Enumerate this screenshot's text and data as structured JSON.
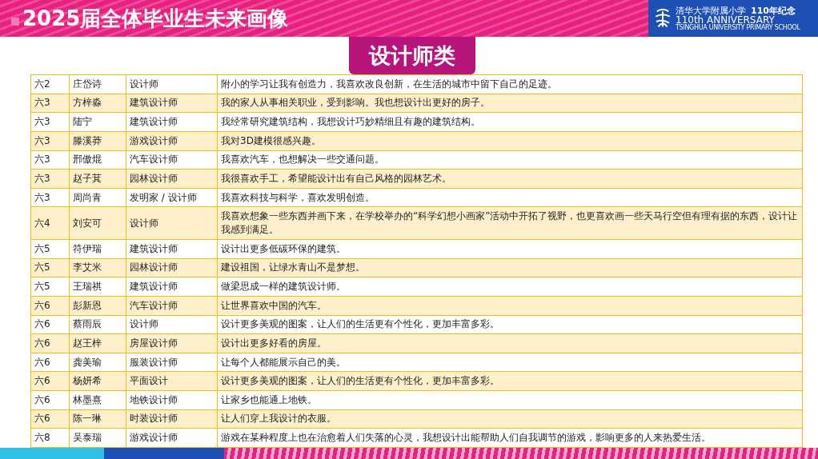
{
  "header": {
    "title": "2025届全体毕业生未来画像",
    "logo": {
      "school": "清华大学附属小学",
      "anniversary": "110年纪念",
      "english": "110th ANNIVERSARY",
      "subtitle": "TSINGHUA UNIVERSITY PRIMARY SCHOOL"
    }
  },
  "category": "设计师类",
  "table": {
    "rows": [
      {
        "class": "六2",
        "name": "庄岱诗",
        "career": "设计师",
        "reason": "附小的学习让我有创造力，我喜欢改良创新，在生活的城市中留下自己的足迹。"
      },
      {
        "class": "六3",
        "name": "方梓淼",
        "career": "建筑设计师",
        "reason": "我的家人从事相关职业，受到影响。我也想设计出更好的房子。"
      },
      {
        "class": "六3",
        "name": "陆宁",
        "career": "建筑设计师",
        "reason": "我经常研究建筑结构，我想设计巧妙精细且有趣的建筑结构。"
      },
      {
        "class": "六3",
        "name": "滕溪莽",
        "career": "游戏设计师",
        "reason": "我对3D建模很感兴趣。"
      },
      {
        "class": "六3",
        "name": "邢傲焜",
        "career": "汽车设计师",
        "reason": "我喜欢汽车，也想解决一些交通问题。"
      },
      {
        "class": "六3",
        "name": "赵子萁",
        "career": "园林设计师",
        "reason": "我很喜欢手工，希望能设计出有自己风格的园林艺术。"
      },
      {
        "class": "六3",
        "name": "周尚青",
        "career": "发明家 / 设计师",
        "reason": "我喜欢科技与科学，喜欢发明创造。"
      },
      {
        "class": "六4",
        "name": "刘安可",
        "career": "设计师",
        "reason": "我喜欢想象一些东西并画下来，在学校举办的“科学幻想小画家”活动中开拓了视野，也更喜欢画一些天马行空但有理有据的东西，设计让我感到满足。"
      },
      {
        "class": "六5",
        "name": "符伊瑞",
        "career": "建筑设计师",
        "reason": "设计出更多低碳环保的建筑。"
      },
      {
        "class": "六5",
        "name": "李艾米",
        "career": "园林设计师",
        "reason": "建设祖国，让绿水青山不是梦想。"
      },
      {
        "class": "六5",
        "name": "王瑞祺",
        "career": "建筑设计师",
        "reason": "做梁思成一样的建筑设计师。"
      },
      {
        "class": "六6",
        "name": "彭新恩",
        "career": "汽车设计师",
        "reason": "让世界喜欢中国的汽车。"
      },
      {
        "class": "六6",
        "name": "蔡雨辰",
        "career": "设计师",
        "reason": "设计更多美观的图案，让人们的生活更有个性化，更加丰富多彩。"
      },
      {
        "class": "六6",
        "name": "赵王梓",
        "career": "房屋设计师",
        "reason": "设计出更多好看的房屋。"
      },
      {
        "class": "六6",
        "name": "龚美瑜",
        "career": "服装设计师",
        "reason": "让每个人都能展示自己的美。"
      },
      {
        "class": "六6",
        "name": "杨妍希",
        "career": "平面设计",
        "reason": "设计更多美观的图案，让人们的生活更有个性化，更加丰富多彩。"
      },
      {
        "class": "六6",
        "name": "林墨熹",
        "career": "地铁设计师",
        "reason": "让家乡也能通上地铁。"
      },
      {
        "class": "六6",
        "name": "陈一琳",
        "career": "时装设计师",
        "reason": "让人们穿上我设计的衣服。"
      },
      {
        "class": "六8",
        "name": "吴泰瑞",
        "career": "游戏设计师",
        "reason": "游戏在某种程度上也在治愈着人们失落的心灵，我想设计出能帮助人们自我调节的游戏，影响更多的人来热爱生活。"
      }
    ]
  }
}
